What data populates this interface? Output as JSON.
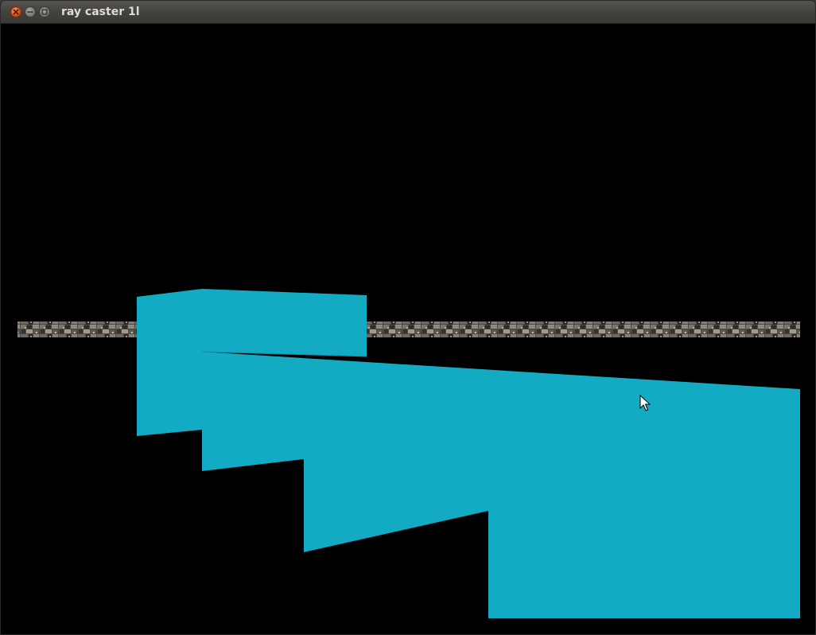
{
  "window": {
    "title": "ray caster 1l",
    "buttons": [
      {
        "name": "close",
        "icon": "close-icon"
      },
      {
        "name": "minimize",
        "icon": "minimize-icon"
      },
      {
        "name": "maximize",
        "icon": "maximize-icon"
      }
    ]
  },
  "scene": {
    "background_color": "#000000",
    "wall_color": "#13aac4",
    "texture_colors": [
      "#4a4744",
      "#6f6a64",
      "#8a857e",
      "#2e2c2a",
      "#5b5753",
      "#9a948c"
    ]
  },
  "cursor": {
    "icon": "arrow-pointer-icon"
  }
}
